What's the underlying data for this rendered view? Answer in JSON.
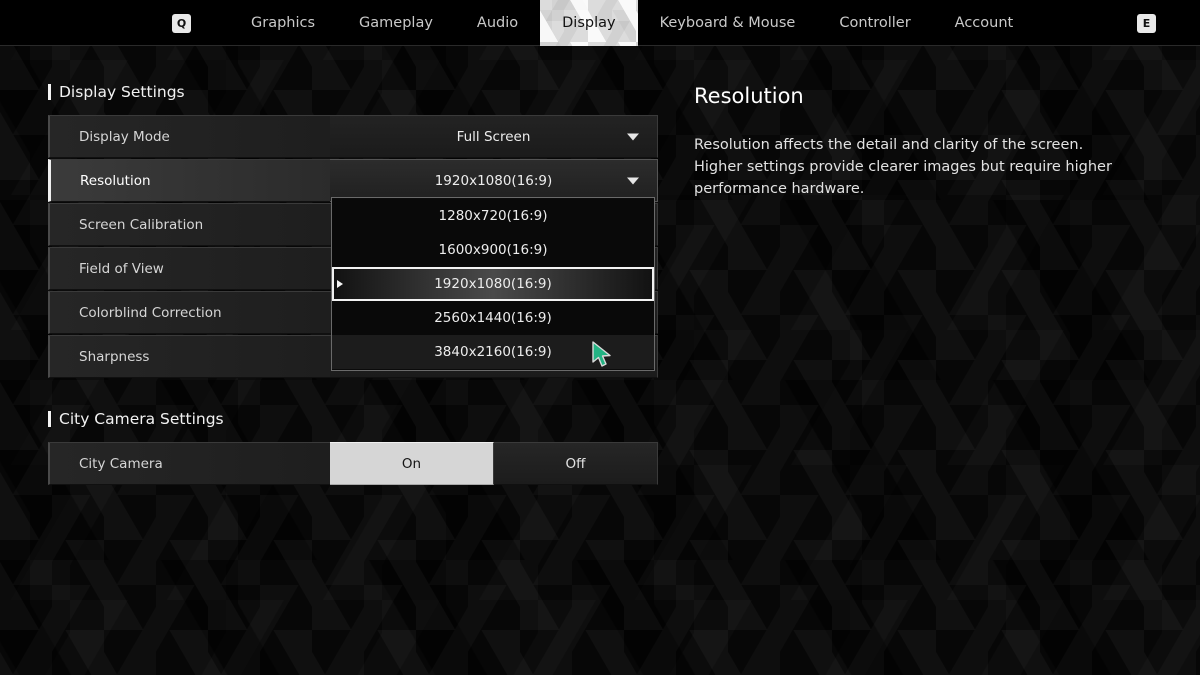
{
  "topbar": {
    "key_left": "Q",
    "key_right": "E",
    "tabs": [
      {
        "label": "Graphics",
        "active": false
      },
      {
        "label": "Gameplay",
        "active": false
      },
      {
        "label": "Audio",
        "active": false
      },
      {
        "label": "Display",
        "active": true
      },
      {
        "label": "Keyboard & Mouse",
        "active": false
      },
      {
        "label": "Controller",
        "active": false
      },
      {
        "label": "Account",
        "active": false
      }
    ]
  },
  "display_section": {
    "heading": "Display Settings",
    "rows": [
      {
        "label": "Display Mode",
        "value": "Full Screen",
        "type": "dropdown",
        "selected": false
      },
      {
        "label": "Resolution",
        "value": "1920x1080(16:9)",
        "type": "dropdown",
        "selected": true
      },
      {
        "label": "Screen Calibration",
        "value": "",
        "type": "plain",
        "selected": false
      },
      {
        "label": "Field of View",
        "value": "",
        "type": "plain",
        "selected": false
      },
      {
        "label": "Colorblind Correction",
        "value": "",
        "type": "plain",
        "selected": false
      },
      {
        "label": "Sharpness",
        "value": "",
        "type": "plain",
        "selected": false
      }
    ]
  },
  "resolution_dropdown": {
    "open": true,
    "options": [
      {
        "label": "1280x720(16:9)",
        "current": false,
        "hover": false
      },
      {
        "label": "1600x900(16:9)",
        "current": false,
        "hover": false
      },
      {
        "label": "1920x1080(16:9)",
        "current": true,
        "hover": false
      },
      {
        "label": "2560x1440(16:9)",
        "current": false,
        "hover": false
      },
      {
        "label": "3840x2160(16:9)",
        "current": false,
        "hover": true
      }
    ]
  },
  "city_camera_section": {
    "heading": "City Camera Settings",
    "row_label": "City Camera",
    "options": [
      {
        "label": "On",
        "selected": true
      },
      {
        "label": "Off",
        "selected": false
      }
    ]
  },
  "info_panel": {
    "title": "Resolution",
    "description": "Resolution affects the detail and clarity of the screen.\nHigher settings provide clearer images but require higher performance hardware."
  },
  "colors": {
    "cursor_fill": "#23b383",
    "cursor_stroke": "#d9d9d9",
    "accent_bar": "#f4f4f4",
    "toggle_on_bg": "#d6d6d6",
    "background": "#070707"
  }
}
